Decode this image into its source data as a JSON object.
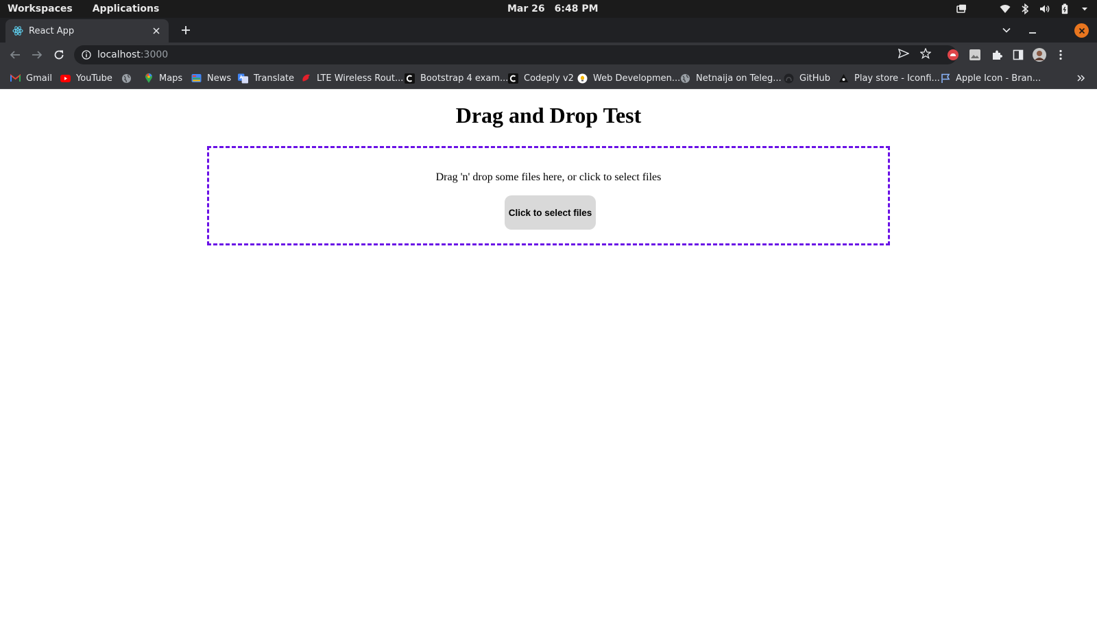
{
  "os_bar": {
    "workspaces": "Workspaces",
    "applications": "Applications",
    "date": "Mar 26",
    "time": "6:48 PM"
  },
  "browser": {
    "tab": {
      "title": "React App"
    },
    "address": {
      "host": "localhost",
      "port": ":3000"
    },
    "bookmarks": [
      {
        "label": "Gmail",
        "icon": "gmail-icon"
      },
      {
        "label": "YouTube",
        "icon": "youtube-icon"
      },
      {
        "label": "",
        "icon": "globe-icon"
      },
      {
        "label": "Maps",
        "icon": "maps-icon"
      },
      {
        "label": "News",
        "icon": "news-icon"
      },
      {
        "label": "Translate",
        "icon": "translate-icon"
      },
      {
        "label": "LTE Wireless Rout...",
        "icon": "router-icon"
      },
      {
        "label": "Bootstrap 4 exam...",
        "icon": "codeply-icon"
      },
      {
        "label": "Codeply v2",
        "icon": "codeply-icon"
      },
      {
        "label": "Web Developmen...",
        "icon": "bulb-icon"
      },
      {
        "label": "Netnaija on Teleg...",
        "icon": "globe-icon"
      },
      {
        "label": "GitHub",
        "icon": "github-icon"
      },
      {
        "label": "Play store - Iconfi...",
        "icon": "iconfinder-icon"
      },
      {
        "label": "Apple Icon - Bran...",
        "icon": "flag-icon"
      }
    ]
  },
  "page": {
    "title": "Drag and Drop Test",
    "dropzone_text": "Drag 'n' drop some files here, or click to select files",
    "select_button": "Click to select files"
  },
  "colors": {
    "dropzone_border": "#6a11e6",
    "button_bg": "#d9d9d9",
    "close_button": "#e9761f"
  }
}
